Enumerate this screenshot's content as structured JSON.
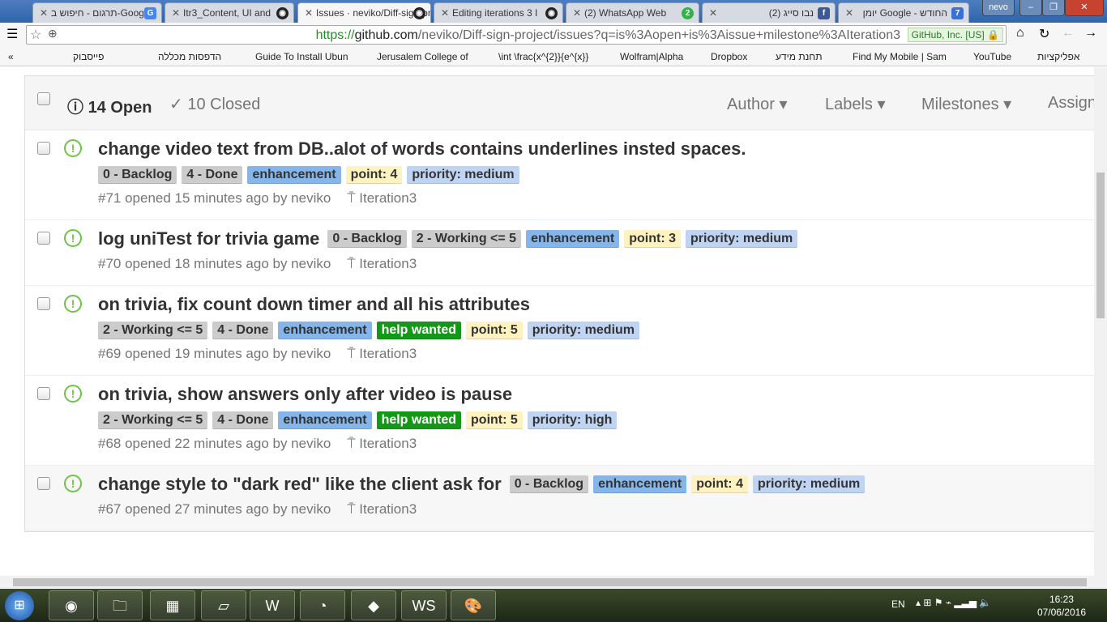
{
  "browser": {
    "tabs": [
      {
        "title": "תרגום - חיפוש ב-Google",
        "icon": "google-icon"
      },
      {
        "title": "Itr3_Content, UI and",
        "icon": "github-icon"
      },
      {
        "title": "Issues · neviko/Diff-sign-project",
        "icon": "github-icon",
        "active": true
      },
      {
        "title": "Editing iterations 3 I",
        "icon": "github-icon"
      },
      {
        "title": "(2) WhatsApp Web",
        "icon": "whatsapp-icon",
        "badge": "2"
      },
      {
        "title": "(2) נבו סייג",
        "icon": "facebook-icon"
      },
      {
        "title": "יומן Google - החודש",
        "icon": "calendar-icon",
        "badge": "7"
      }
    ],
    "profile": "nevo",
    "url_scheme": "https://",
    "url_host": "github.com",
    "url_path": "/neviko/Diff-sign-project/issues?q=is%3Aopen+is%3Aissue+milestone%3AIteration3",
    "ev_cert": "GitHub, Inc. [US]",
    "bookmarks": [
      "פייסבוק",
      "הדפסות מכללה",
      "Guide To Install Ubun",
      "Jerusalem College of",
      "\\int \\frac{x^{2}}{e^{x}}",
      "Wolfram|Alpha",
      "Dropbox",
      "תחנת מידע",
      "Find My Mobile | Sam",
      "YouTube",
      "אפליקציות"
    ]
  },
  "issues_header": {
    "open": "14 Open",
    "closed": "10 Closed",
    "filters": [
      "Author ▾",
      "Labels ▾",
      "Milestones ▾",
      "Assign"
    ]
  },
  "issues": [
    {
      "title": "change video text from DB..alot of words contains underlines insted spaces.",
      "labels": [
        "0 - Backlog",
        "4 - Done",
        "enhancement",
        "point: 4",
        "priority: medium"
      ],
      "meta": "#71 opened 15 minutes ago by neviko",
      "milestone": "Iteration3"
    },
    {
      "title": "log uniTest for trivia game",
      "labels": [
        "0 - Backlog",
        "2 - Working <= 5",
        "enhancement",
        "point: 3",
        "priority: medium"
      ],
      "meta": "#70 opened 18 minutes ago by neviko",
      "milestone": "Iteration3"
    },
    {
      "title": "on trivia, fix count down timer and all his attributes",
      "labels": [
        "2 - Working <= 5",
        "4 - Done",
        "enhancement",
        "help wanted",
        "point: 5",
        "priority: medium"
      ],
      "meta": "#69 opened 19 minutes ago by neviko",
      "milestone": "Iteration3"
    },
    {
      "title": "on trivia, show answers only after video is pause",
      "labels": [
        "2 - Working <= 5",
        "4 - Done",
        "enhancement",
        "help wanted",
        "point: 5",
        "priority: high"
      ],
      "meta": "#68 opened 22 minutes ago by neviko",
      "milestone": "Iteration3"
    },
    {
      "title": "change style to \"dark red\" like the client ask for",
      "labels": [
        "0 - Backlog",
        "enhancement",
        "point: 4",
        "priority: medium"
      ],
      "meta": "#67 opened 27 minutes ago by neviko",
      "milestone": "Iteration3"
    }
  ],
  "label_colors": {
    "0 - Backlog": "#cccccc",
    "2 - Working <= 5": "#cccccc",
    "4 - Done": "#cccccc",
    "enhancement": "#84b6eb",
    "help wanted": "#159818",
    "point: 3": "#fef2c0",
    "point: 4": "#fef2c0",
    "point: 5": "#fef2c0",
    "priority: medium": "#bfd4f2",
    "priority: high": "#bfd4f2"
  },
  "taskbar": {
    "lang": "EN",
    "time": "16:23",
    "date": "07/06/2016"
  }
}
